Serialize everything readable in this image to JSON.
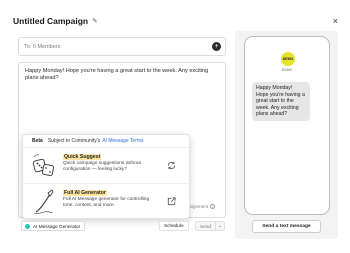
{
  "header": {
    "title": "Untitled Campaign",
    "edit_icon": "pencil-icon",
    "close_icon": "close-icon",
    "close_label": "×"
  },
  "recipients": {
    "label": "To: 0 Members",
    "add_label": "+"
  },
  "compose": {
    "message": "Happy Monday! Hope you're having a great start to the week. Any exciting plans ahead?",
    "assign_hint": "ssignment",
    "info_label": "i"
  },
  "ai_popup": {
    "badge": "Beta",
    "subject_text": "Subject to Community's",
    "terms_link": "AI Message Terms",
    "items": [
      {
        "title": "Quick Suggest",
        "description": "Quick campaign suggestions without configuration — feeling lucky?",
        "action_icon": "refresh-icon",
        "illustration": "dice-illustration"
      },
      {
        "title": "Full AI Generator",
        "description": "Full AI Message generator for controlling tone, content, and more.",
        "action_icon": "external-link-icon",
        "illustration": "pen-illustration"
      }
    ]
  },
  "footer": {
    "ai_button": "AI Message Generator",
    "schedule": "Schedule",
    "send": "Send",
    "send_caret": "⌄"
  },
  "preview": {
    "avatar_label": "DEMO",
    "avatar_caption": "DEMO",
    "bubble": "Happy Monday! Hope you're having a great start to the week. Any exciting plans ahead?",
    "test_button": "Send a text message"
  },
  "colors": {
    "link": "#2f6fd6",
    "avatar": "#e8e22e",
    "ai_dot": "#2ec3bd",
    "highlight": "#ffe7a0"
  }
}
